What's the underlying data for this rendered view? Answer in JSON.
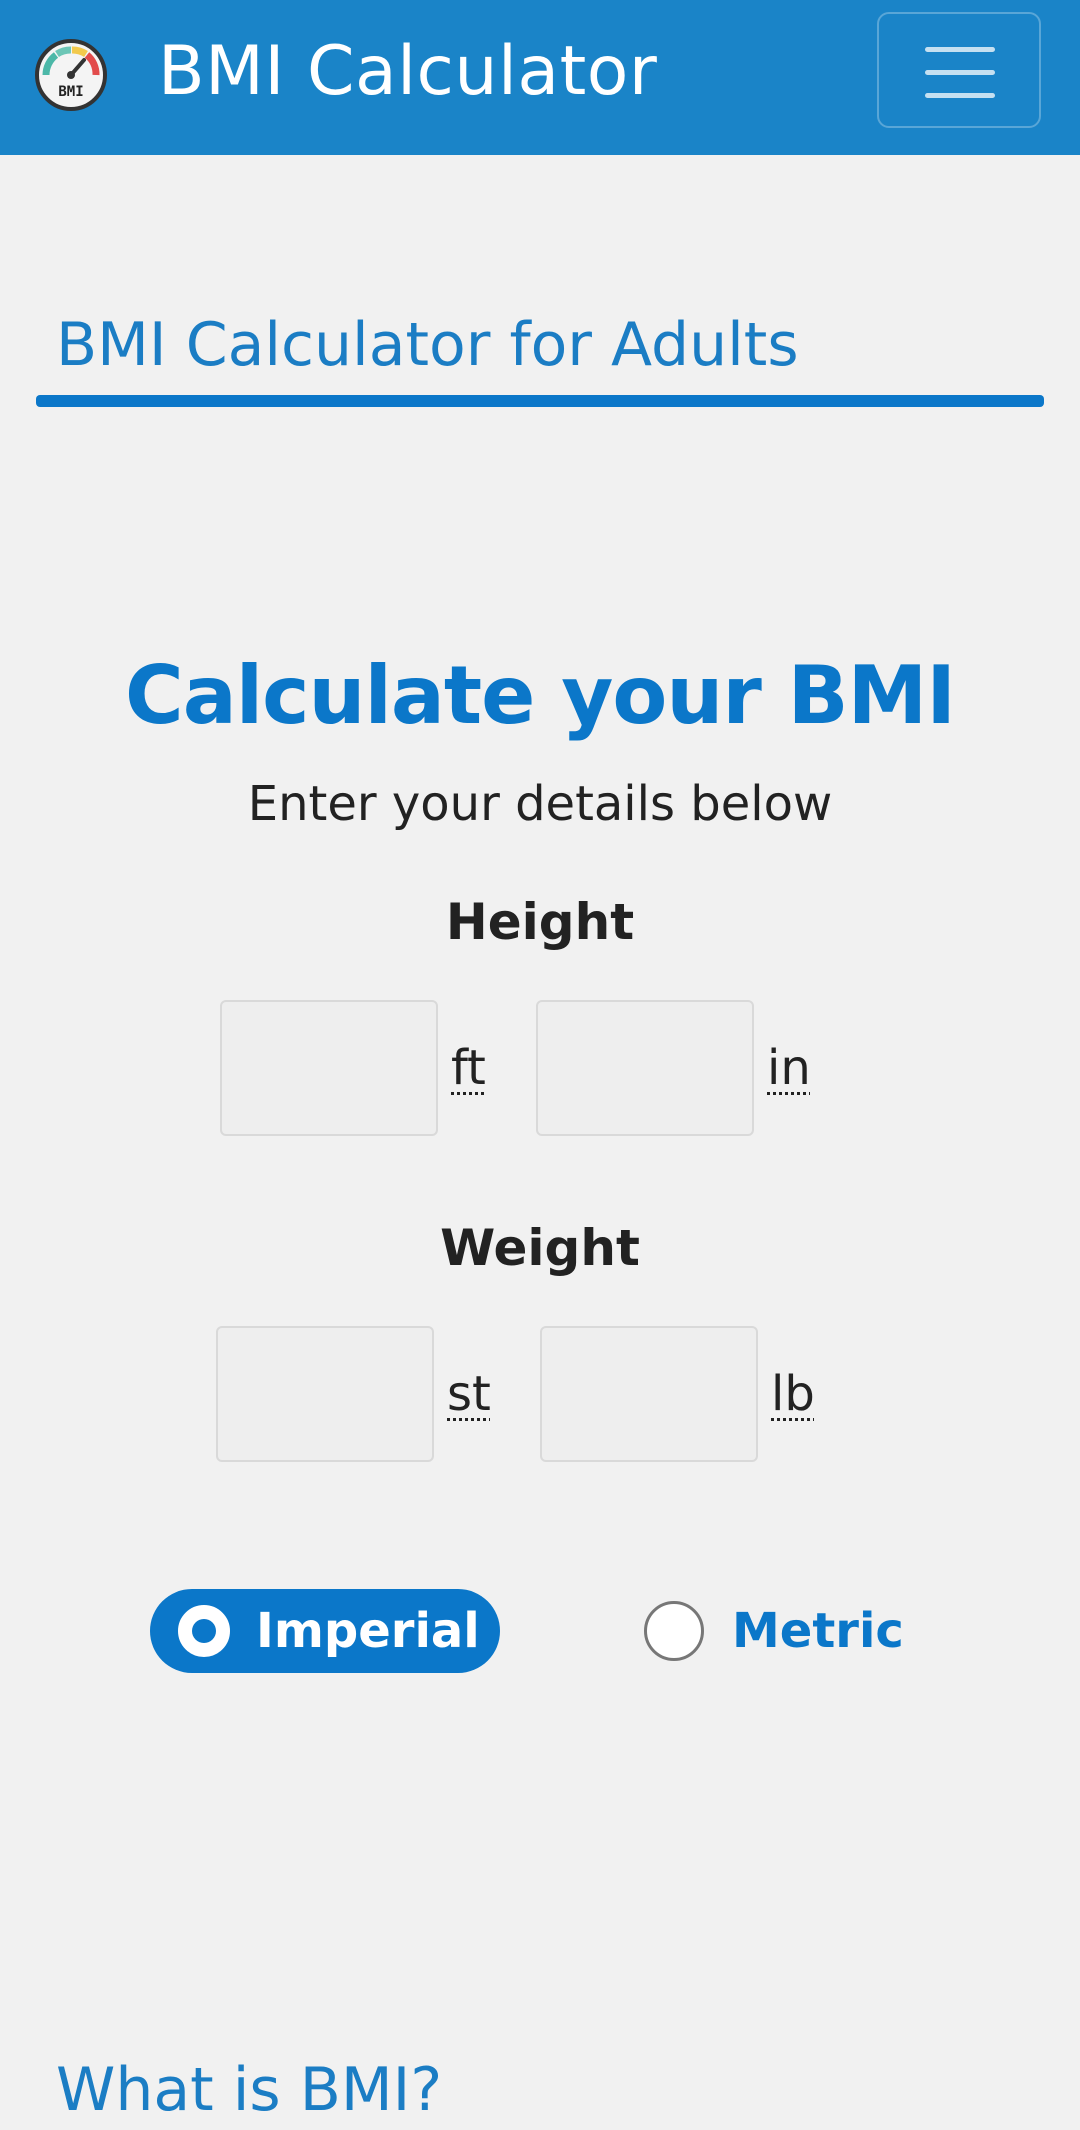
{
  "header": {
    "title": "BMI Calculator",
    "logo_icon": "bmi-gauge-icon",
    "logo_text": "BMI",
    "menu_icon": "hamburger-menu-icon"
  },
  "section": {
    "title": "BMI Calculator for Adults"
  },
  "calculator": {
    "title": "Calculate your BMI",
    "subtitle": "Enter your details below",
    "height": {
      "label": "Height",
      "ft_value": "",
      "in_value": "",
      "ft_unit": "ft",
      "in_unit": "in"
    },
    "weight": {
      "label": "Weight",
      "st_value": "",
      "lb_value": "",
      "st_unit": "st",
      "lb_unit": "lb"
    },
    "units": {
      "imperial_label": "Imperial",
      "metric_label": "Metric",
      "selected": "Imperial"
    }
  },
  "next_section": {
    "title": "What is BMI?"
  },
  "colors": {
    "navbar": "#1a84c8",
    "accent": "#0b77c9",
    "background": "#f1f1f1"
  }
}
